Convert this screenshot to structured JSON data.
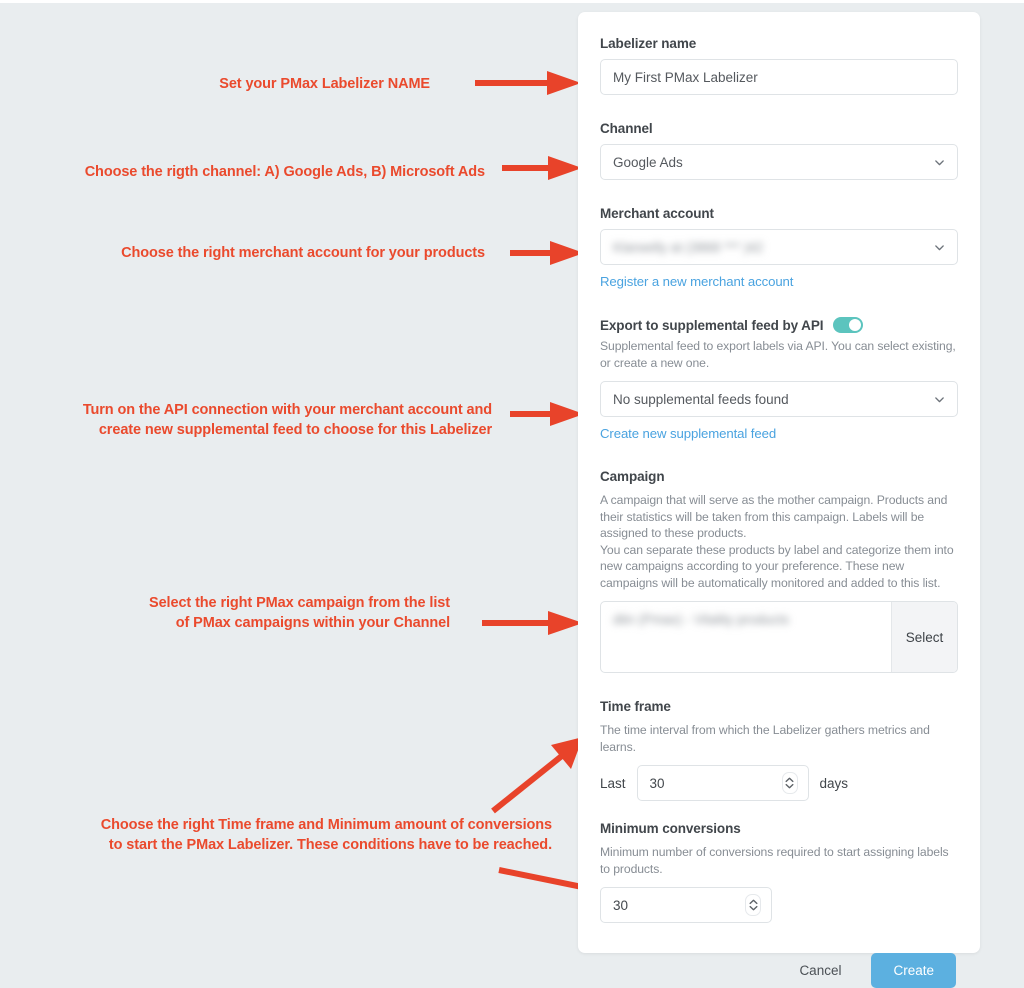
{
  "theme": {
    "page_bg": "#e9edef",
    "card_bg": "#ffffff",
    "annotation_color": "#ea4a2d",
    "link_color": "#4aa3e0",
    "toggle_on_color": "#5cc4be",
    "primary_button_color": "#5cb0e0",
    "label_color": "#41464b",
    "help_color": "#878d94"
  },
  "form": {
    "labelizer_name": {
      "label": "Labelizer name",
      "value": "My First PMax Labelizer"
    },
    "channel": {
      "label": "Channel",
      "value": "Google Ads"
    },
    "merchant_account": {
      "label": "Merchant account",
      "value": "Klarwelly at (3868 *** )42",
      "register_link": "Register a new merchant account"
    },
    "supplemental_feed": {
      "label": "Export to supplemental feed by API",
      "toggle_state": "on",
      "help": "Supplemental feed to export labels via API. You can select existing, or create a new one.",
      "value": "No supplemental feeds found",
      "create_link": "Create new supplemental feed"
    },
    "campaign": {
      "label": "Campaign",
      "help_1": "A campaign that will serve as the mother campaign. Products and their statistics will be taken from this campaign. Labels will be assigned to these products.",
      "help_2": "You can separate these products by label and categorize them into new campaigns according to your preference. These new campaigns will be automatically monitored and added to this list.",
      "value": "dtin (Pmax) - Vitality products",
      "select_button": "Select"
    },
    "time_frame": {
      "label": "Time frame",
      "help": "The time interval from which the Labelizer gathers metrics and learns.",
      "prefix": "Last",
      "value": "30",
      "suffix": "days"
    },
    "minimum_conversions": {
      "label": "Minimum conversions",
      "help": "Minimum number of conversions required to start assigning labels to products.",
      "value": "30"
    },
    "footer": {
      "cancel_label": "Cancel",
      "create_label": "Create"
    }
  },
  "annotations": [
    {
      "id": "name",
      "text": "Set your PMax Labelizer NAME"
    },
    {
      "id": "channel",
      "text": "Choose the rigth channel: A) Google Ads, B) Microsoft Ads"
    },
    {
      "id": "merchant",
      "text": "Choose the right merchant account for your products"
    },
    {
      "id": "api",
      "text": "Turn on the API connection with your merchant account and\ncreate new supplemental feed to choose for this Labelizer"
    },
    {
      "id": "campaign",
      "text": "Select the right PMax campaign from the list\nof PMax campaigns within your Channel"
    },
    {
      "id": "timeframe",
      "text": "Choose the right Time frame and Minimum amount of conversions\nto start the PMax Labelizer. These conditions have to be reached."
    }
  ]
}
